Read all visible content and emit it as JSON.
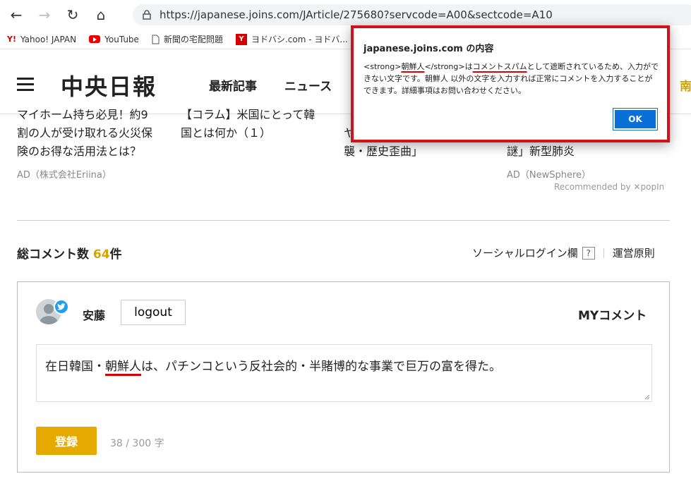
{
  "browser": {
    "url": "https://japanese.joins.com/JArticle/275680?servcode=A00&sectcode=A10",
    "bookmarks": [
      "Yahoo! JAPAN",
      "YouTube",
      "新聞の宅配問題",
      "ヨドバシ.com - ヨドバ..."
    ]
  },
  "header": {
    "logo": "中央日報",
    "nav": [
      "最新記事",
      "ニュース"
    ],
    "nav_cut": "南"
  },
  "cards": [
    {
      "lines": [
        "マイホーム持ち必見！約9",
        "割の人が受け取れる火災保",
        "険のお得な活用法とは？"
      ],
      "ad": "AD（株式会社Eriina）"
    },
    {
      "lines": [
        "【コラム】米国にとって韓",
        "国とは何か（１）"
      ]
    },
    {
      "lines": [
        "ヤ",
        "襲・歴史歪曲」"
      ]
    },
    {
      "lines": [
        "謎」新型肺炎"
      ],
      "ad": "AD（NewSphere）"
    }
  ],
  "recommended": "Recommended by ✕popIn",
  "comments": {
    "count_label": "総コメント数",
    "count": "64",
    "count_suffix": "件",
    "social_login": "ソーシャルログイン欄",
    "help": "?",
    "policy": "運営原則",
    "username": "安藤",
    "logout": "logout",
    "my_comment": "MYコメント",
    "text_before": "在日韓国・",
    "text_highlight": "朝鮮人",
    "text_after": "は、パチンコという反社会的・半賭博的な事業で巨万の富を得た。",
    "submit": "登録",
    "char_count": "38 / 300 字"
  },
  "dialog": {
    "title": "japanese.joins.com の内容",
    "msg_strong_open": "<strong>",
    "msg_word": "朝鮮人",
    "msg_strong_close": "</strong>",
    "msg_part1": "は",
    "msg_spam": "コメントスパム",
    "msg_part2": "として遮断されているため、入力ができない文字です。朝鮮人 以外の文字を入力すれば正常にコメントを入力することができます。詳細事項はお問い合わせください。",
    "ok": "OK"
  },
  "colors": {
    "accent": "#e5a900",
    "alert_border": "#d0121b",
    "ok_button": "#0a6fd6"
  }
}
